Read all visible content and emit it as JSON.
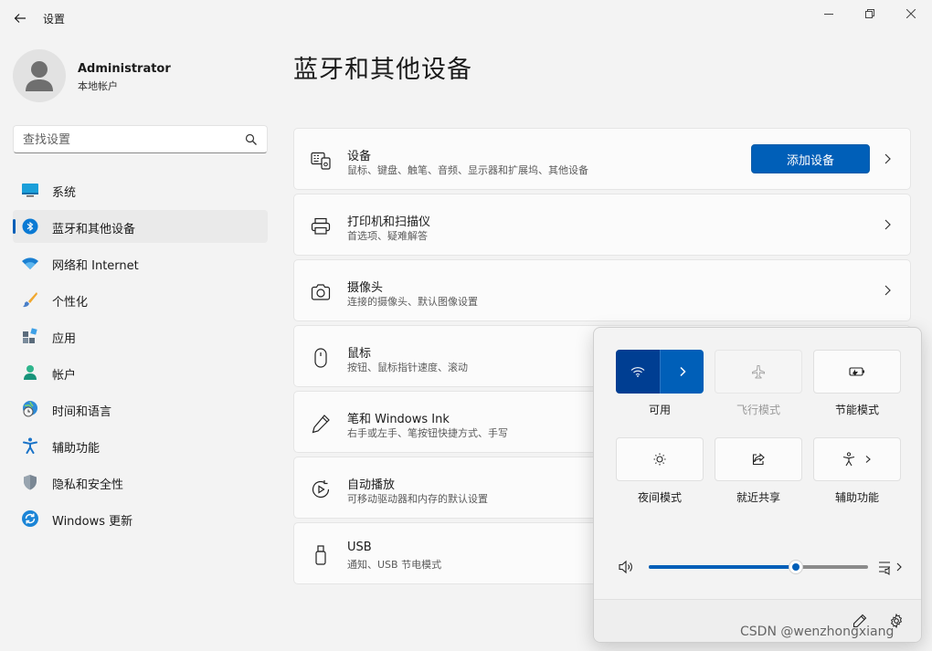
{
  "app": {
    "title": "设置"
  },
  "user": {
    "name": "Administrator",
    "account_type": "本地帐户"
  },
  "search": {
    "placeholder": "查找设置"
  },
  "nav": {
    "items": [
      {
        "label": "系统",
        "icon": "monitor-icon",
        "active": false
      },
      {
        "label": "蓝牙和其他设备",
        "icon": "bluetooth-icon",
        "active": true
      },
      {
        "label": "网络和 Internet",
        "icon": "wifi-icon",
        "active": false
      },
      {
        "label": "个性化",
        "icon": "brush-icon",
        "active": false
      },
      {
        "label": "应用",
        "icon": "apps-icon",
        "active": false
      },
      {
        "label": "帐户",
        "icon": "person-icon",
        "active": false
      },
      {
        "label": "时间和语言",
        "icon": "globe-clock-icon",
        "active": false
      },
      {
        "label": "辅助功能",
        "icon": "accessibility-icon",
        "active": false
      },
      {
        "label": "隐私和安全性",
        "icon": "shield-icon",
        "active": false
      },
      {
        "label": "Windows 更新",
        "icon": "update-icon",
        "active": false
      }
    ]
  },
  "main": {
    "title": "蓝牙和其他设备",
    "add_device_label": "添加设备",
    "cards": [
      {
        "title": "设备",
        "subtitle": "鼠标、键盘、触笔、音频、显示器和扩展坞、其他设备",
        "icon": "devices-icon"
      },
      {
        "title": "打印机和扫描仪",
        "subtitle": "首选项、疑难解答",
        "icon": "printer-icon"
      },
      {
        "title": "摄像头",
        "subtitle": "连接的摄像头、默认图像设置",
        "icon": "camera-icon"
      },
      {
        "title": "鼠标",
        "subtitle": "按钮、鼠标指针速度、滚动",
        "icon": "mouse-icon"
      },
      {
        "title": "笔和 Windows Ink",
        "subtitle": "右手或左手、笔按钮快捷方式、手写",
        "icon": "pen-icon"
      },
      {
        "title": "自动播放",
        "subtitle": "可移动驱动器和内存的默认设置",
        "icon": "autoplay-icon"
      },
      {
        "title": "USB",
        "subtitle": "通知、USB 节电模式",
        "icon": "usb-icon"
      }
    ]
  },
  "quick_settings": {
    "tiles": [
      {
        "label": "可用",
        "icon": "wifi-icon",
        "state": "on"
      },
      {
        "label": "飞行模式",
        "icon": "airplane-icon",
        "state": "disabled"
      },
      {
        "label": "节能模式",
        "icon": "battery-saver-icon",
        "state": "off"
      },
      {
        "label": "夜间模式",
        "icon": "brightness-icon",
        "state": "off"
      },
      {
        "label": "就近共享",
        "icon": "share-icon",
        "state": "off"
      },
      {
        "label": "辅助功能",
        "icon": "accessibility-icon",
        "state": "off"
      }
    ],
    "volume_level": 0.67,
    "colors": {
      "accent": "#005fb8",
      "accent_dark": "#003e92"
    }
  },
  "watermark": "CSDN @wenzhongxiang"
}
